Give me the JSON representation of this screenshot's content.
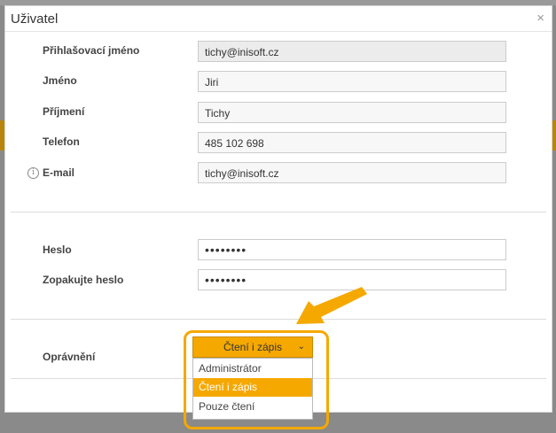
{
  "dialog": {
    "title": "Uživatel",
    "close_glyph": "×"
  },
  "form": {
    "login": {
      "label": "Přihlašovací jméno",
      "value": "tichy@inisoft.cz"
    },
    "first_name": {
      "label": "Jméno",
      "value": "Jiri"
    },
    "last_name": {
      "label": "Příjmení",
      "value": "Tichy"
    },
    "phone": {
      "label": "Telefon",
      "value": "485 102 698"
    },
    "email": {
      "label": "E-mail",
      "value": "tichy@inisoft.cz"
    },
    "password": {
      "label": "Heslo",
      "value": "••••••••"
    },
    "password_repeat": {
      "label": "Zopakujte heslo",
      "value": "••••••••"
    },
    "permission": {
      "label": "Oprávnění",
      "selected": "Čtení i zápis",
      "options": [
        "Administrátor",
        "Čtení i zápis",
        "Pouze čtení"
      ]
    }
  },
  "colors": {
    "accent": "#f5a800",
    "info_icon": "#888888"
  },
  "icons": [
    "close-icon",
    "info-icon",
    "chevron-down-icon",
    "arrow-icon"
  ]
}
